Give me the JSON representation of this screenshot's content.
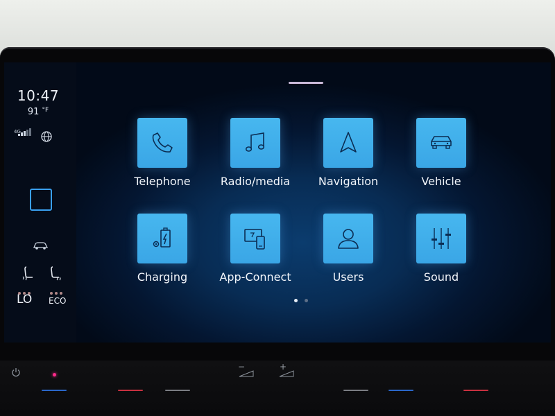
{
  "status": {
    "time": "10:47",
    "temperature_value": "91",
    "temperature_unit": "°F",
    "network": "4G"
  },
  "climate": {
    "left_level": "LO",
    "right_mode": "ECO"
  },
  "apps": [
    {
      "label": "Telephone",
      "icon": "phone-icon"
    },
    {
      "label": "Radio/media",
      "icon": "music-note-icon"
    },
    {
      "label": "Navigation",
      "icon": "navigation-arrow-icon"
    },
    {
      "label": "Vehicle",
      "icon": "car-icon"
    },
    {
      "label": "Charging",
      "icon": "battery-charging-icon"
    },
    {
      "label": "App-Connect",
      "icon": "phone-mirror-icon"
    },
    {
      "label": "Users",
      "icon": "user-icon"
    },
    {
      "label": "Sound",
      "icon": "sliders-icon"
    }
  ],
  "pager": {
    "pages": 2,
    "current": 1
  },
  "controls": {
    "minus_label": "−",
    "plus_label": "+"
  },
  "colors": {
    "tile": "#3aa6e6",
    "accent": "#3aa0f0",
    "led": "#ff2a8a"
  }
}
